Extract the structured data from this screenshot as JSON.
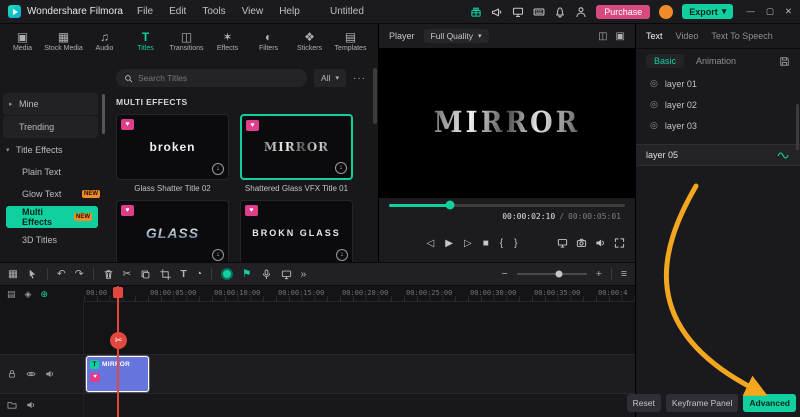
{
  "glyphs": {
    "caret_down": "▾",
    "chevron_right": "▸",
    "chevron_down": "▾",
    "more_dots": "···",
    "minimize": "—",
    "maximize": "▢",
    "close": "✕",
    "heart": "♥",
    "download_arrow": "↓",
    "scissors": "✂"
  },
  "titlebar": {
    "app_name": "Wondershare Filmora",
    "menus": [
      {
        "label": "File"
      },
      {
        "label": "Edit"
      },
      {
        "label": "Tools"
      },
      {
        "label": "View"
      },
      {
        "label": "Help"
      }
    ],
    "project_title": "Untitled",
    "purchase_label": "Purchase",
    "export_label": "Export"
  },
  "media_tabs": {
    "items": [
      {
        "label": "Media",
        "glyph": "▣"
      },
      {
        "label": "Stock Media",
        "glyph": "▦"
      },
      {
        "label": "Audio",
        "glyph": "♫"
      },
      {
        "label": "Titles",
        "glyph": "T"
      },
      {
        "label": "Transitions",
        "glyph": "◫"
      },
      {
        "label": "Effects",
        "glyph": "✶"
      },
      {
        "label": "Filters",
        "glyph": "◐"
      },
      {
        "label": "Stickers",
        "glyph": "❖"
      },
      {
        "label": "Templates",
        "glyph": "▤"
      }
    ]
  },
  "search": {
    "placeholder": "Search Titles",
    "filter_label": "All"
  },
  "sidebar": {
    "items": [
      {
        "label": "Mine"
      },
      {
        "label": "Trending"
      },
      {
        "label": "Title Effects"
      },
      {
        "label": "Plain Text"
      },
      {
        "label": "Glow Text",
        "badge": "NEW"
      },
      {
        "label": "Multi Effects",
        "badge": "NEW"
      },
      {
        "label": "3D Titles"
      }
    ]
  },
  "library": {
    "section_title": "MULTI EFFECTS",
    "items": [
      {
        "title": "Glass Shatter Title 02",
        "thumb_text": "broken"
      },
      {
        "title": "Shattered Glass VFX Title 01",
        "thumb_text": "MIRROR"
      },
      {
        "title": "",
        "thumb_text": "GLASS"
      },
      {
        "title": "",
        "thumb_text": "BROKN GLASS"
      }
    ]
  },
  "player": {
    "panel_label": "Player",
    "quality_label": "Full Quality",
    "preview_text": "MIRROR",
    "time_current": "00:00:02:10",
    "time_separator": "/",
    "time_total": "00:00:05:01",
    "view_icons": [
      {
        "name": "split-view-icon",
        "glyph": "◫"
      },
      {
        "name": "mask-view-icon",
        "glyph": "▣"
      }
    ],
    "transport": [
      {
        "name": "step-back",
        "glyph": "◁"
      },
      {
        "name": "play",
        "glyph": "▶"
      },
      {
        "name": "step-forward",
        "glyph": "▷"
      },
      {
        "name": "stop",
        "glyph": "■"
      },
      {
        "name": "mark-in",
        "glyph": "{"
      },
      {
        "name": "mark-out",
        "glyph": "}"
      }
    ]
  },
  "properties": {
    "tabs": [
      {
        "label": "Text"
      },
      {
        "label": "Video"
      },
      {
        "label": "Text To Speech"
      }
    ],
    "subtabs": [
      {
        "label": "Basic"
      },
      {
        "label": "Animation"
      }
    ],
    "layer_icon_glyph": "◎",
    "layers": [
      {
        "label": "layer 01"
      },
      {
        "label": "layer 02"
      },
      {
        "label": "layer 03"
      }
    ],
    "active_layer_label": "layer 05",
    "footer_buttons": [
      {
        "label": "Reset"
      },
      {
        "label": "Keyframe Panel"
      },
      {
        "label": "Advanced"
      }
    ]
  },
  "toolbar": {
    "icons": [
      {
        "name": "workspace-layout-icon",
        "glyph": "▦"
      },
      {
        "name": "undo-icon",
        "glyph": "↶"
      },
      {
        "name": "redo-icon",
        "glyph": "↷"
      },
      {
        "name": "split-scissors-icon",
        "glyph": "✂"
      },
      {
        "name": "text-tool-icon",
        "glyph": "T"
      },
      {
        "name": "speed-icon",
        "glyph": "◔"
      },
      {
        "name": "marker-flag-icon",
        "glyph": "⚑"
      },
      {
        "name": "more-tools-icon",
        "glyph": "»"
      }
    ],
    "zoom_out": "−",
    "zoom_in": "+",
    "menu_icon": "≡"
  },
  "timeline": {
    "corner_icons": [
      {
        "name": "manage-tracks-icon",
        "glyph": "▤"
      },
      {
        "name": "snap-icon",
        "glyph": "◈"
      },
      {
        "name": "motion-track-icon",
        "glyph": "⊕"
      }
    ],
    "ruler_ticks": [
      {
        "label": "00:00"
      },
      {
        "label": "00:00:05:00"
      },
      {
        "label": "00:00:10:00"
      },
      {
        "label": "00:00:15:00"
      },
      {
        "label": "00:00:20:00"
      },
      {
        "label": "00:00:25:00"
      },
      {
        "label": "00:00:30:00"
      },
      {
        "label": "00:00:35:00"
      },
      {
        "label": "00:00:4"
      }
    ],
    "clip": {
      "label": "MIRROR",
      "badge_glyph": "T"
    }
  },
  "colors": {
    "accent": "#10d0a0",
    "purchase": "#d84a7f",
    "arrow": "#f2a71f",
    "clip": "#6674dd",
    "heart": "#e03d8a",
    "playhead": "#e2483d"
  }
}
